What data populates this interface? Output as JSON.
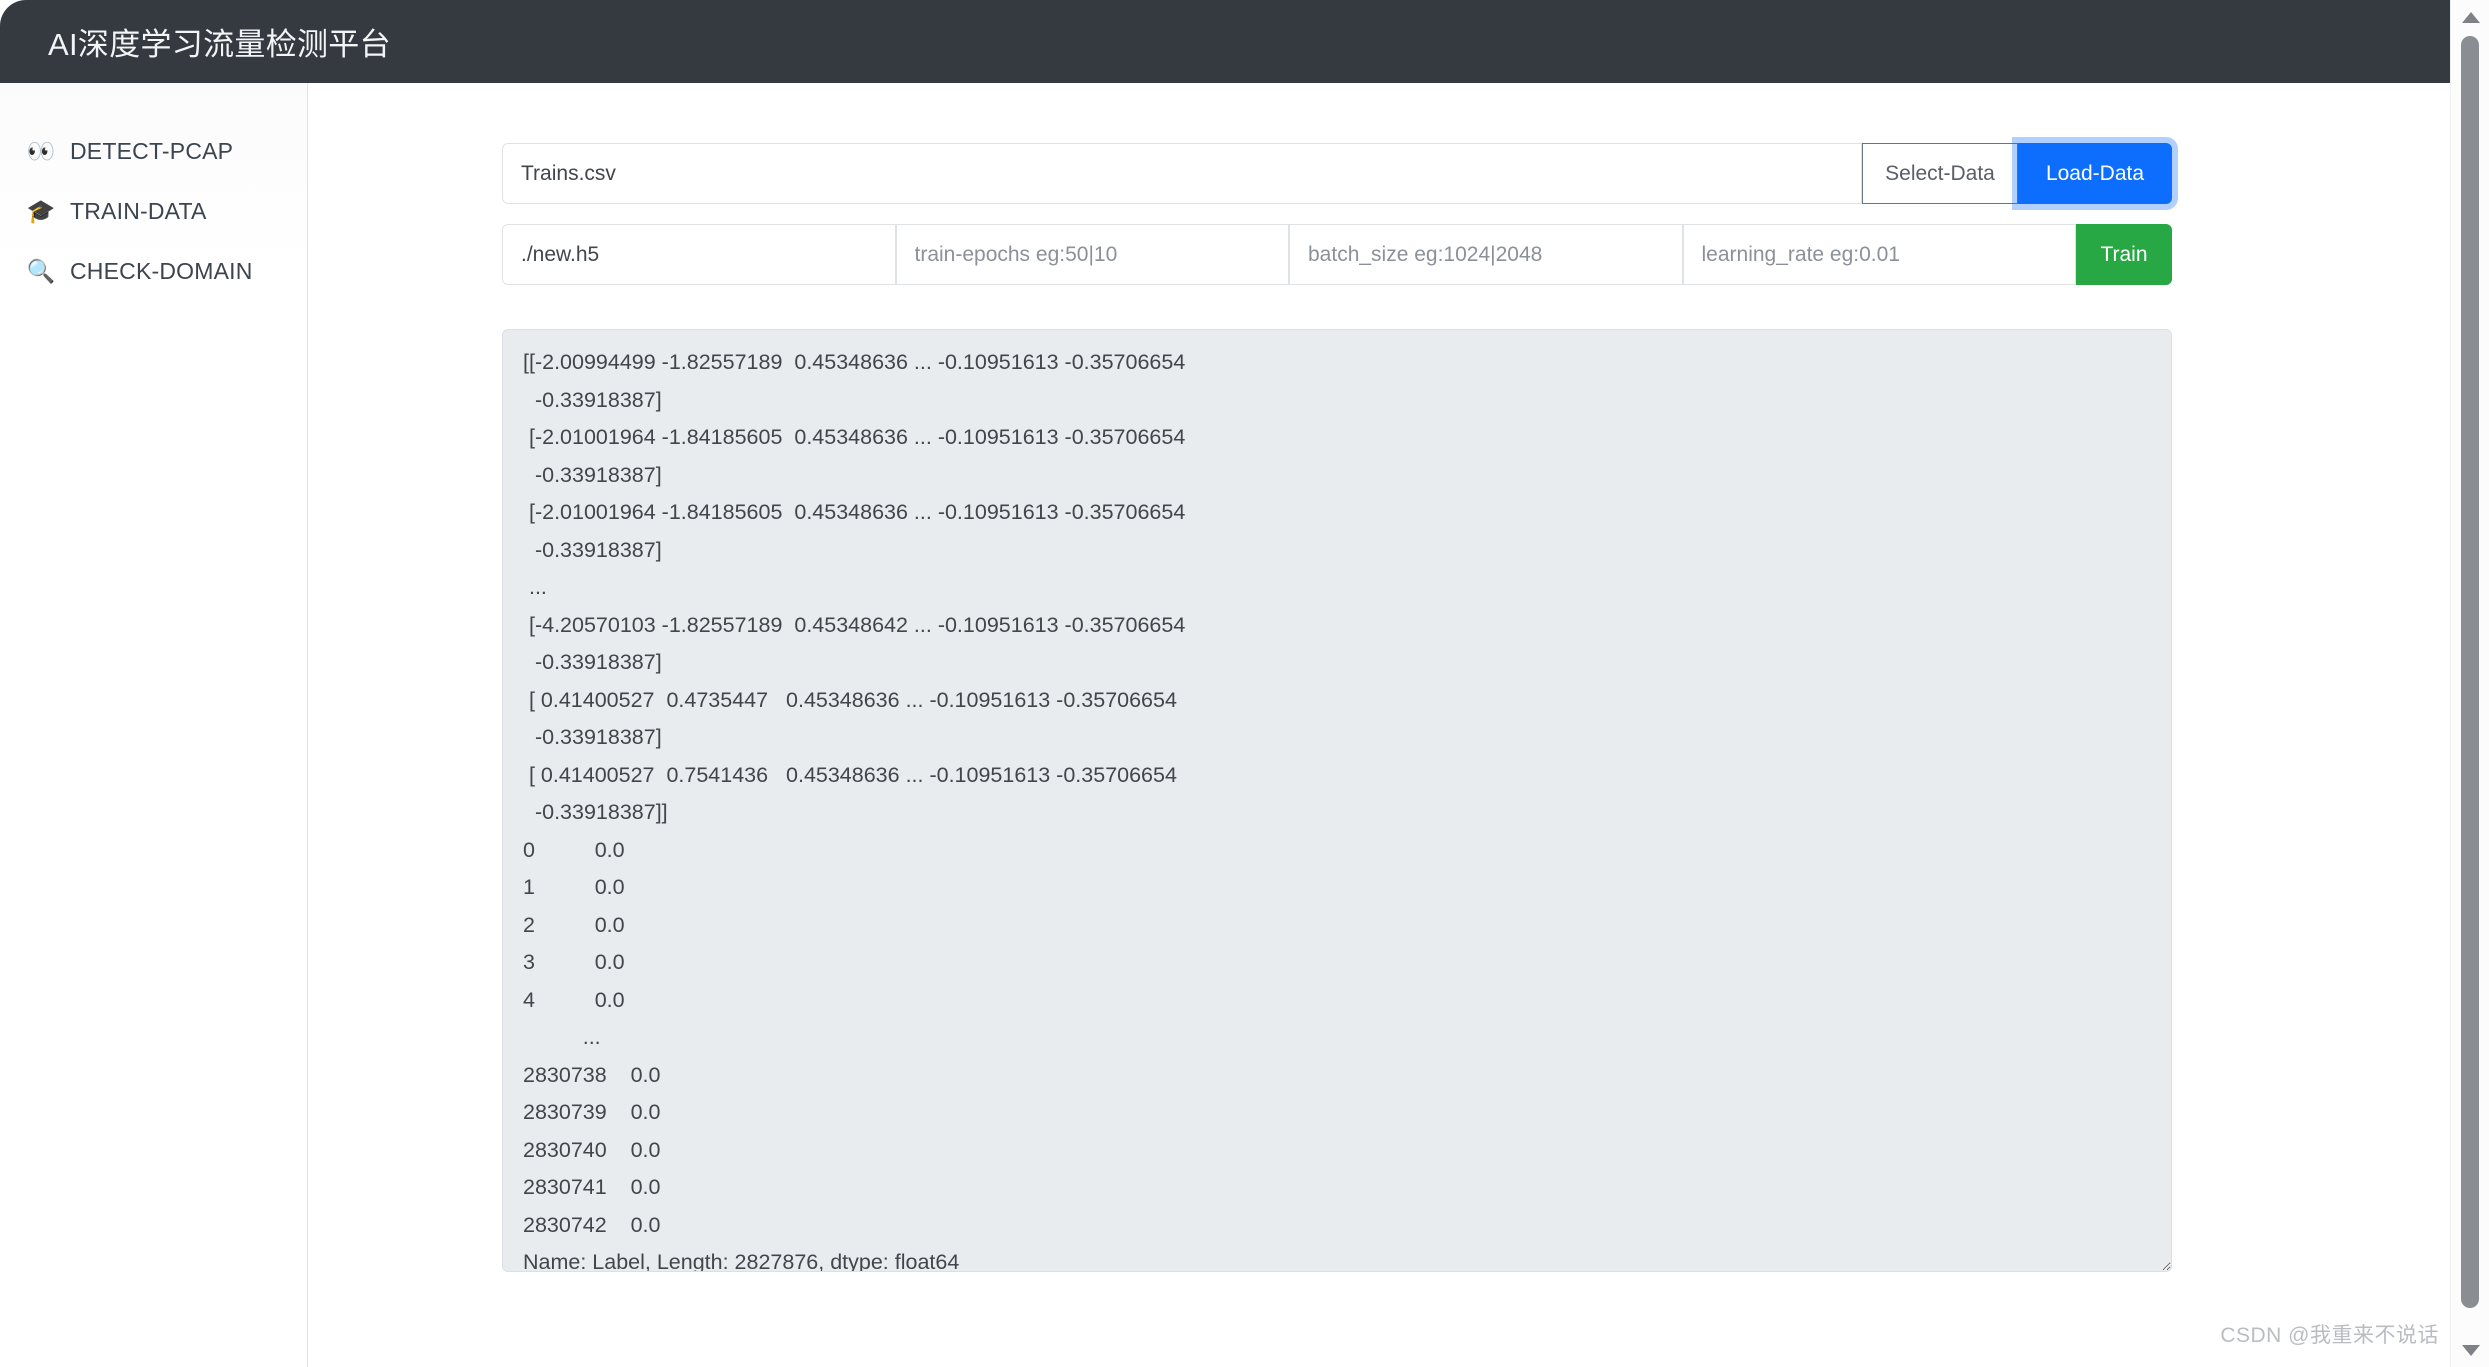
{
  "header": {
    "title": "AI深度学习流量检测平台"
  },
  "sidebar": {
    "items": [
      {
        "icon": "👀",
        "icon_name": "eyes-icon",
        "label": "DETECT-PCAP"
      },
      {
        "icon": "🎓",
        "icon_name": "graduation-cap-icon",
        "label": "TRAIN-DATA"
      },
      {
        "icon": "🔍",
        "icon_name": "magnifier-icon",
        "label": "CHECK-DOMAIN"
      }
    ]
  },
  "data_row": {
    "file_value": "Trains.csv",
    "file_placeholder": "",
    "select_label": "Select-Data",
    "load_label": "Load-Data"
  },
  "train_row": {
    "model_value": "./new.h5",
    "epochs_placeholder": "train-epochs eg:50|10",
    "epochs_value": "",
    "batch_placeholder": "batch_size eg:1024|2048",
    "batch_value": "",
    "lr_placeholder": "learning_rate eg:0.01",
    "lr_value": "",
    "train_label": "Train"
  },
  "output": {
    "text": "[[-2.00994499 -1.82557189  0.45348636 ... -0.10951613 -0.35706654\n  -0.33918387]\n [-2.01001964 -1.84185605  0.45348636 ... -0.10951613 -0.35706654\n  -0.33918387]\n [-2.01001964 -1.84185605  0.45348636 ... -0.10951613 -0.35706654\n  -0.33918387]\n ...\n [-4.20570103 -1.82557189  0.45348642 ... -0.10951613 -0.35706654\n  -0.33918387]\n [ 0.41400527  0.4735447   0.45348636 ... -0.10951613 -0.35706654\n  -0.33918387]\n [ 0.41400527  0.7541436   0.45348636 ... -0.10951613 -0.35706654\n  -0.33918387]]\n0          0.0\n1          0.0\n2          0.0\n3          0.0\n4          0.0\n          ...\n2830738    0.0\n2830739    0.0\n2830740    0.0\n2830741    0.0\n2830742    0.0\nName: Label, Length: 2827876, dtype: float64"
  },
  "watermark": {
    "text": "CSDN @我重来不说话"
  },
  "colors": {
    "header_bg": "#343a40",
    "primary": "#0d6efd",
    "success": "#28a745",
    "output_bg": "#e8ecef",
    "sidebar_border": "#e3e3e3"
  }
}
